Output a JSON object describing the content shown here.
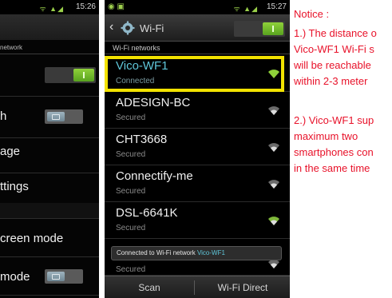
{
  "left_screen": {
    "status_time": "15:26",
    "section_label": "network",
    "rows": [
      {
        "label": ""
      },
      {
        "label": "h"
      },
      {
        "label": "age"
      },
      {
        "label": "ttings"
      },
      {
        "label": "creen mode"
      },
      {
        "label": " mode"
      }
    ]
  },
  "wifi_screen": {
    "status_time": "15:27",
    "title": "Wi-Fi",
    "section_label": "Wi-Fi networks",
    "networks": [
      {
        "name": "Vico-WF1",
        "status": "Connected"
      },
      {
        "name": "ADESIGN-BC",
        "status": "Secured"
      },
      {
        "name": "CHT3668",
        "status": "Secured"
      },
      {
        "name": "Connectify-me",
        "status": "Secured"
      },
      {
        "name": "DSL-6641K",
        "status": "Secured"
      },
      {
        "name": "",
        "status": "Secured"
      }
    ],
    "toast": {
      "prefix": "Connected to Wi-Fi network ",
      "network": "Vico-WF1"
    },
    "buttons": {
      "scan": "Scan",
      "wifi_direct": "Wi-Fi Direct"
    }
  },
  "notice": {
    "heading": "Notice :",
    "lines": [
      "1.) The distance o",
      "Vico-WF1 Wi-Fi s",
      "will be reachable",
      "within 2-3 meter",
      "2.) Vico-WF1 sup",
      "maximum two",
      "smartphones con",
      "in the same time"
    ]
  },
  "colors": {
    "notice_text": "#e8122a",
    "highlight_border": "#f2e200",
    "connected_text": "#5fc6d9",
    "toggle_on": "#7cc12f"
  }
}
